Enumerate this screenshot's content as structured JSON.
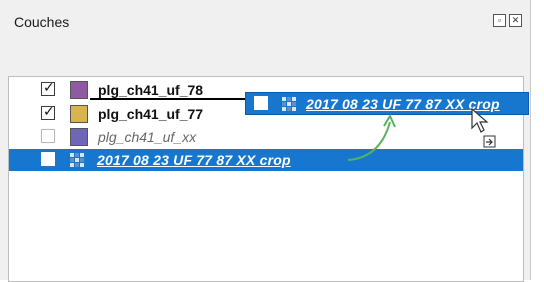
{
  "panel": {
    "title": "Couches",
    "window_buttons": [
      "float-icon",
      "close-icon"
    ]
  },
  "toolbar": {
    "icons": [
      "style-brush-icon",
      "add-group-icon",
      "visibility-eye-icon",
      "filter-icon",
      "expression-filter-icon",
      "expand-all-icon",
      "collapse-all-icon",
      "remove-layer-icon"
    ]
  },
  "layers": [
    {
      "name": "plg_ch41_uf_78",
      "checked": true,
      "color": "#8e5aa2",
      "style": "bold"
    },
    {
      "name": "plg_ch41_uf_77",
      "checked": true,
      "color": "#d8b450",
      "style": "bold"
    },
    {
      "name": "plg_ch41_uf_xx",
      "checked": false,
      "color": "#6f66b8",
      "style": "italic"
    },
    {
      "name": "2017 08 23 UF 77 87 XX crop",
      "checked": false,
      "type": "raster",
      "selected": true
    }
  ],
  "drag": {
    "ghost_label": "2017 08 23 UF 77 87 XX crop",
    "arrow_color": "#57b35a",
    "selection_color": "#1777cf"
  }
}
